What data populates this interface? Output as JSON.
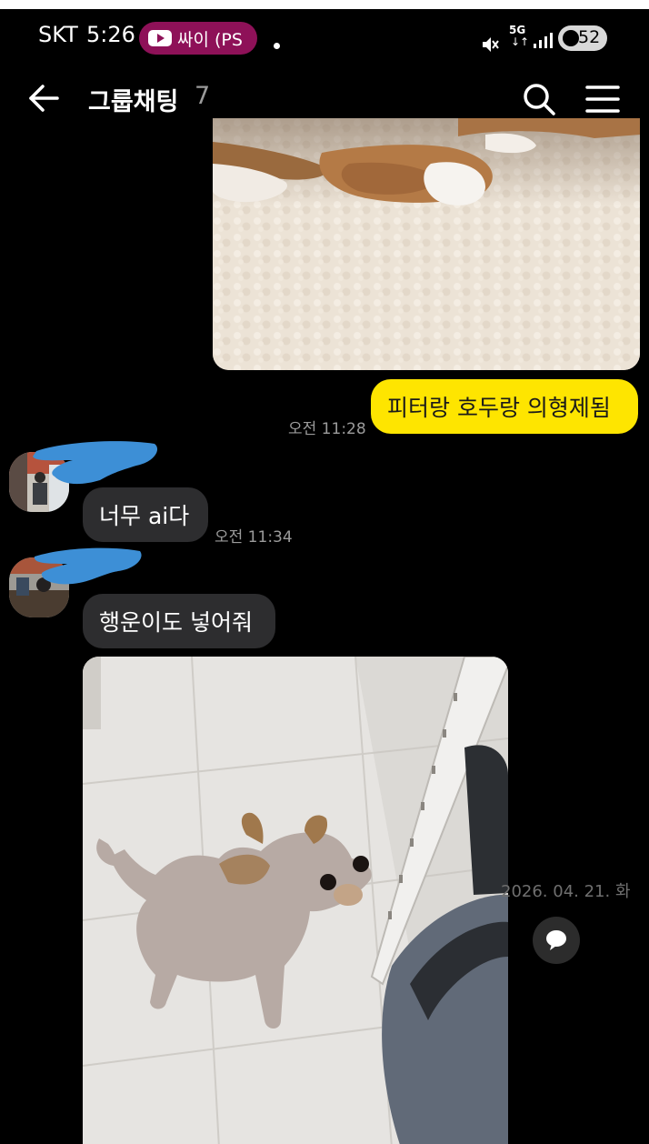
{
  "status_bar": {
    "carrier": "SKT",
    "time": "5:26",
    "media_pill": "싸이 (PS",
    "network": "5G",
    "network_arrows": "↓↑",
    "battery": "52"
  },
  "header": {
    "title": "그룹채팅",
    "member_count": "7"
  },
  "messages": [
    {
      "sender": "me",
      "text": "피터랑 호두랑 의형제됨",
      "time": "오전 11:28"
    },
    {
      "sender": "member",
      "text": "너무 ai다",
      "time": "오전 11:34"
    },
    {
      "sender": "member",
      "text": "행운이도 넣어줘",
      "time": ""
    }
  ],
  "photo_overlay": {
    "date": "2026. 04. 21. 화"
  },
  "icons": {
    "back": "arrow-left-icon",
    "search": "search-icon",
    "menu": "hamburger-menu-icon",
    "comment": "speech-bubble-icon",
    "mute": "mute-icon",
    "signal": "signal-icon"
  },
  "colors": {
    "background": "#000000",
    "my_bubble": "#fee500",
    "their_bubble": "#2d2d2f",
    "media_pill": "#8e1158",
    "timestamp": "#9b9b9b"
  }
}
